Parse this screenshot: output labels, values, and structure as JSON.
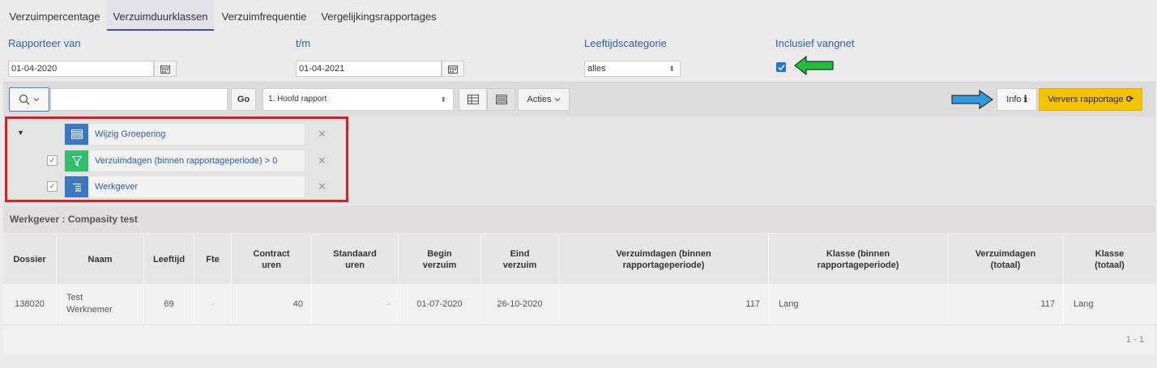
{
  "tabs": [
    {
      "label": "Verzuimpercentage"
    },
    {
      "label": "Verzuimduurklassen"
    },
    {
      "label": "Verzuimfrequentie"
    },
    {
      "label": "Vergelijkingsrapportages"
    }
  ],
  "filters": {
    "rapporteer_van_label": "Rapporteer van",
    "rapporteer_van_value": "01-04-2020",
    "tm_label": "t/m",
    "tm_value": "01-04-2021",
    "leeftijd_label": "Leeftijdscategorie",
    "leeftijd_value": "alles",
    "vangnet_label": "Inclusief vangnet"
  },
  "toolbar": {
    "go_label": "Go",
    "report_value": "1. Hoofd rapport",
    "acties_label": "Acties",
    "info_label": "Info",
    "refresh_label": "Ververs rapportage"
  },
  "config": {
    "group_label": "Wijzig Groepering",
    "filter_label": "Verzuimdagen (binnen rapportageperiode) > 0",
    "control_label": "Werkgever"
  },
  "group_header": "Werkgever : Compasity test",
  "table": {
    "headers": [
      "Dossier",
      "Naam",
      "Leeftijd",
      "Fte",
      "Contract uren",
      "Standaard uren",
      "Begin verzuim",
      "Eind verzuim",
      "Verzuimdagen (binnen rapportageperiode)",
      "Klasse (binnen rapportageperiode)",
      "Verzuimdagen (totaal)",
      "Klasse (totaal)"
    ],
    "row": {
      "dossier": "138020",
      "naam_1": "Test",
      "naam_2": "Werknemer",
      "leeftijd": "69",
      "fte": "-",
      "contract_uren": "40",
      "standaard_uren": "-",
      "begin": "01-07-2020",
      "eind": "26-10-2020",
      "vd_binnen": "117",
      "klasse_binnen": "Lang",
      "vd_totaal": "117",
      "klasse_totaal": "Lang"
    },
    "pagination": "1 - 1"
  },
  "colors": {
    "accent": "#2f5fa7",
    "refresh": "#f5c400",
    "highlight_box": "#e01b24",
    "arrow_green": "#22c03a",
    "arrow_blue": "#2f9ae0"
  }
}
